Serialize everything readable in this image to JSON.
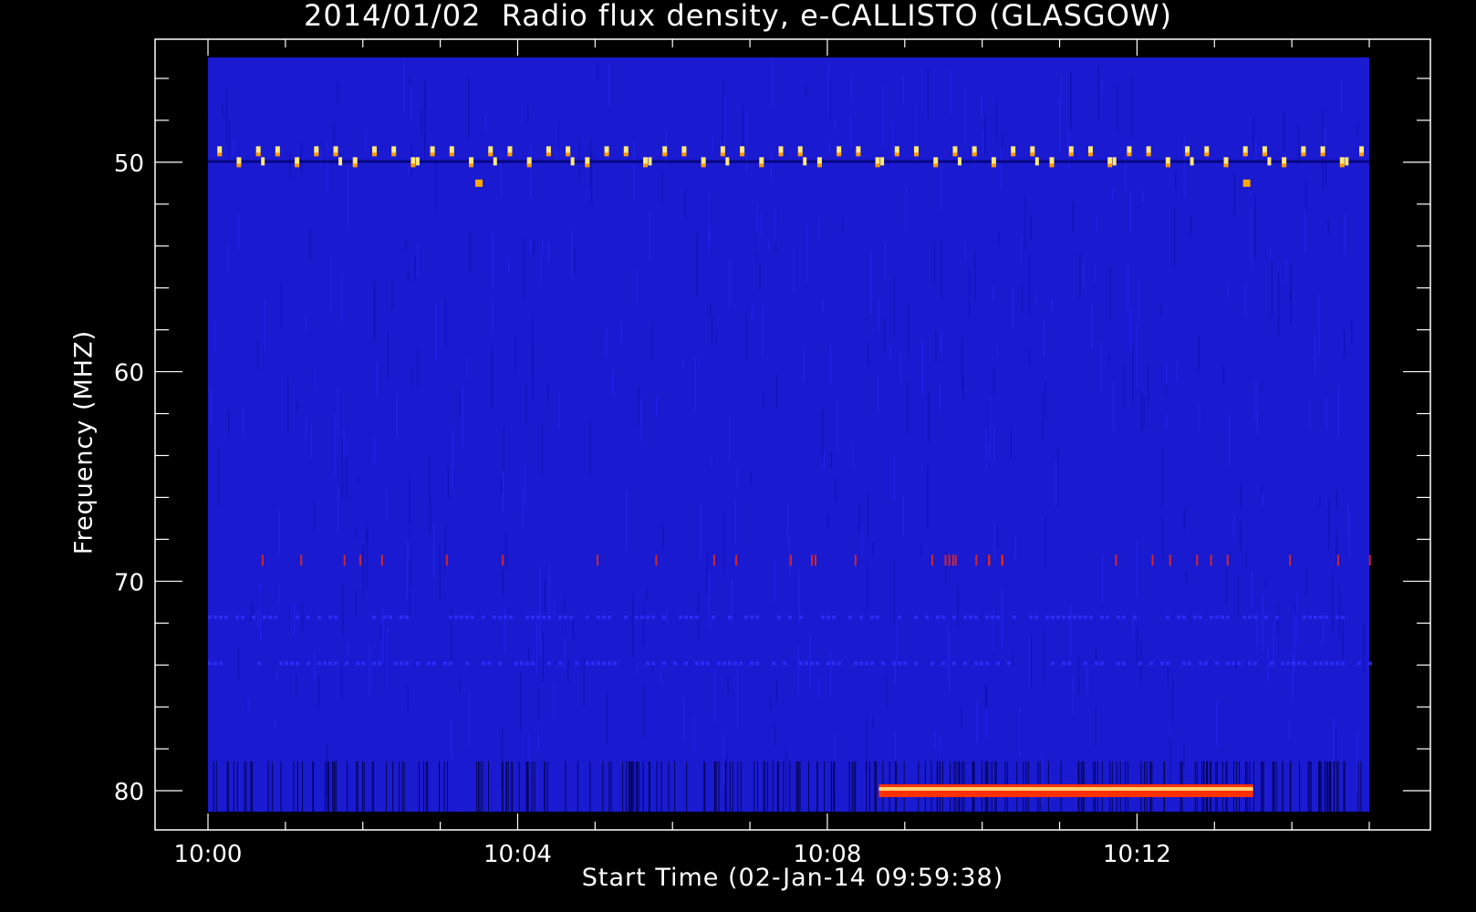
{
  "chart_data": {
    "type": "heatmap",
    "title": "2014/01/02  Radio flux density, e-CALLISTO (GLASGOW)",
    "xlabel": "Start Time (02-Jan-14 09:59:38)",
    "ylabel": "Frequency (MHZ)",
    "x_ticks": [
      "10:00",
      "10:04",
      "10:08",
      "10:12"
    ],
    "y_ticks": [
      "50",
      "60",
      "70",
      "80"
    ],
    "y_tick_values": [
      50,
      60,
      70,
      80
    ],
    "x_range_minutes": [
      0,
      15
    ],
    "y_range_mhz": [
      45,
      81
    ],
    "y_axis_inverted": true,
    "colormap": [
      "#0000ff",
      "#1010c0",
      "#ff2a00",
      "#ff8c00",
      "#ffe87a"
    ],
    "background_level": "#1a1ad0",
    "features": [
      {
        "name": "periodic bursts",
        "freq_mhz": 49.5,
        "time_range": [
          "10:00",
          "10:15"
        ],
        "color": "#ffe87a"
      },
      {
        "name": "isolated spot",
        "freq_mhz": 51,
        "time": "10:03:30",
        "color": "#ffa800"
      },
      {
        "name": "isolated spot",
        "freq_mhz": 51,
        "time": "10:13:25",
        "color": "#ffa800"
      },
      {
        "name": "weak emission",
        "freq_mhz": 69,
        "time_range": [
          "10:00",
          "10:15"
        ],
        "color": "#ff2a00"
      },
      {
        "name": "continuous band",
        "freq_mhz": 80,
        "time_range": [
          "10:08:40",
          "10:13:30"
        ],
        "color": "#ff8c00"
      }
    ]
  }
}
